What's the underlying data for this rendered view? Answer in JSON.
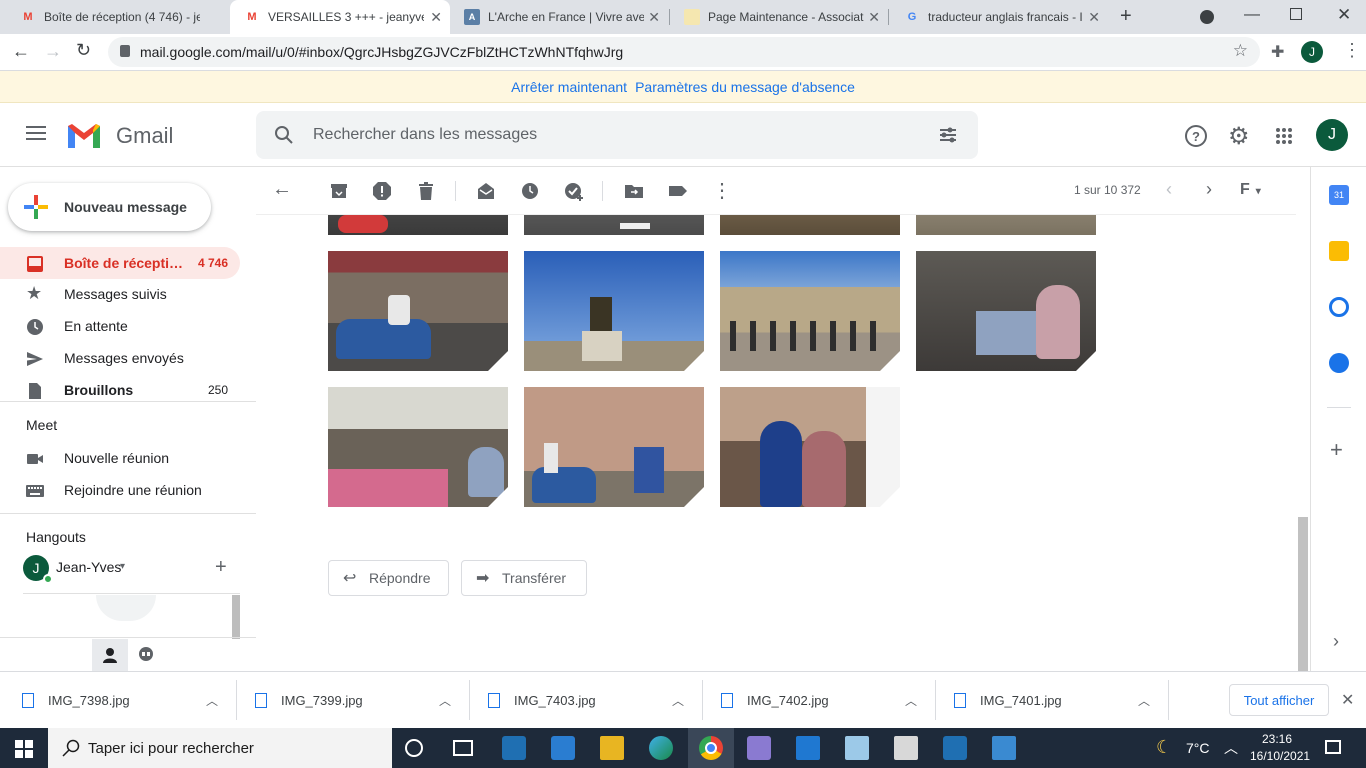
{
  "browser": {
    "tabs": [
      {
        "title": "Boîte de réception (4 746) - je",
        "favicon": "gmail-icon"
      },
      {
        "title": "VERSAILLES 3 +++ - jeanyves",
        "favicon": "gmail-icon"
      },
      {
        "title": "L'Arche en France | Vivre avec",
        "favicon": "arche-icon"
      },
      {
        "title": "Page Maintenance - Associat",
        "favicon": "page-icon"
      },
      {
        "title": "traducteur anglais francais - I",
        "favicon": "google-icon"
      }
    ],
    "url": "mail.google.com/mail/u/0/#inbox/QgrcJHsbgZGJVCzFblZtHCTzWhNTfqhwJrg",
    "profile_initial": "J"
  },
  "vacation": {
    "stop_label": "Arrêter maintenant",
    "settings_label": "Paramètres du message d'absence"
  },
  "gmail": {
    "logo_text": "Gmail",
    "search_placeholder": "Rechercher dans les messages",
    "avatar_initial": "J"
  },
  "sidebar": {
    "compose_label": "Nouveau message",
    "items": [
      {
        "label": "Boîte de récepti…",
        "count": "4 746"
      },
      {
        "label": "Messages suivis",
        "count": ""
      },
      {
        "label": "En attente",
        "count": ""
      },
      {
        "label": "Messages envoyés",
        "count": ""
      },
      {
        "label": "Brouillons",
        "count": "250"
      }
    ],
    "meet_title": "Meet",
    "meet_items": [
      "Nouvelle réunion",
      "Rejoindre une réunion"
    ],
    "hangouts_title": "Hangouts",
    "hangouts_user": "Jean-Yves",
    "hangouts_initial": "J"
  },
  "main": {
    "pagination": "1 sur 10 372",
    "lang_label": "F",
    "reply_label": "Répondre",
    "forward_label": "Transférer"
  },
  "downloads": {
    "files": [
      "IMG_7398.jpg",
      "IMG_7399.jpg",
      "IMG_7403.jpg",
      "IMG_7402.jpg",
      "IMG_7401.jpg"
    ],
    "show_all_label": "Tout afficher"
  },
  "taskbar": {
    "search_placeholder": "Taper ici pour rechercher",
    "weather": "7°C",
    "time": "23:16",
    "date": "16/10/2021"
  }
}
